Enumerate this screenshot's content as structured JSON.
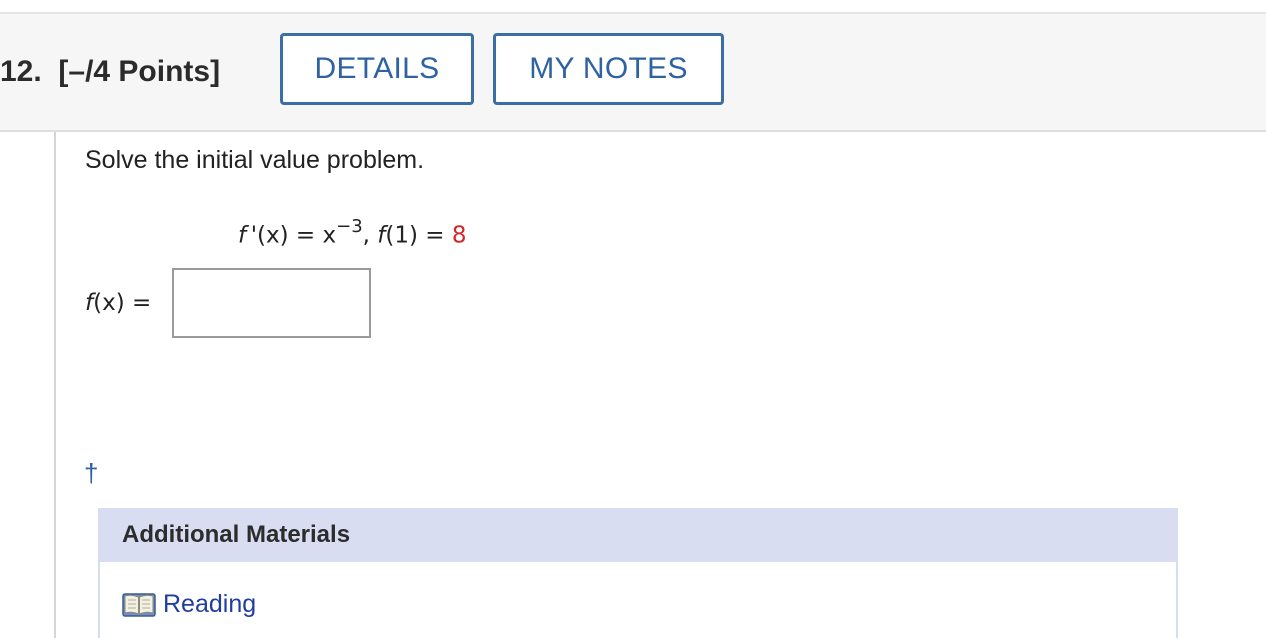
{
  "question": {
    "number": "12.",
    "points": "[–/4 Points]"
  },
  "header_buttons": {
    "details": "DETAILS",
    "notes": "MY NOTES"
  },
  "problem": {
    "prompt": "Solve the initial value problem.",
    "equation": {
      "f_prime": "f '",
      "x_paren": "(x)",
      "eq1": " = ",
      "x_base": "x",
      "exponent": "−3",
      "comma": ", ",
      "f_name": "f",
      "arg": "(1)",
      "eq2": " = ",
      "value": "8"
    },
    "answer": {
      "f_name": "f",
      "x_paren": "(x)",
      "eq": " = ",
      "value": "",
      "placeholder": ""
    },
    "footnote_mark": "†"
  },
  "additional_materials": {
    "title": "Additional Materials",
    "items": [
      {
        "label": "Reading",
        "icon": "book-icon"
      }
    ]
  },
  "colors": {
    "accent": "#2f62a0",
    "given_value": "#d3262a",
    "materials_header": "#d8ddf2"
  }
}
